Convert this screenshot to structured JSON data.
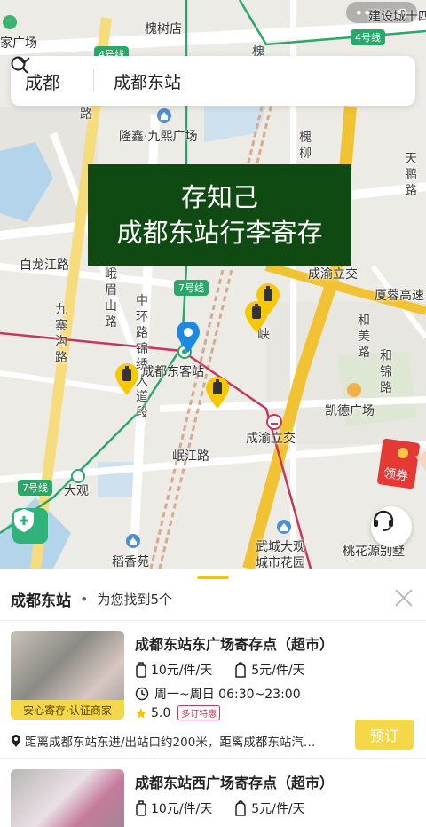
{
  "map": {
    "labels": {
      "huaishu_store": "槐树店",
      "home_plaza": "家广场",
      "longxin_plaza": "隆鑫·九熙广场",
      "bailong_rd": "白龙江路",
      "jiuzhai_rd": "九寨沟路",
      "emei_rd": "峨眉山路",
      "zhonghuan_rd": "中环路锦绣大道段",
      "east_station": "成都东客站",
      "minjiang_rd": "岷江路",
      "chengyu_lijiao_top": "成渝立交",
      "chengyu_lijiao": "成渝立交",
      "xiamen_rong": "厦蓉高速",
      "hemei_rd": "和美路",
      "jinhe_rd": "和锦路",
      "kaide_plaza": "凯德广场",
      "daguan": "大观",
      "daoxiangyuan": "稻香苑",
      "wucheng": "武城大观",
      "city_garden": "城市花园",
      "taohua_villa": "桃花源别墅",
      "tianpeng_rd": "天鹏路",
      "huai_rd": "槐",
      "huaishu_rd": "槐柳",
      "xia_rd": "峡",
      "shan_rd": "山路",
      "lu_top": "路",
      "jiandi": "建设城十四",
      "huai_top": "槐"
    },
    "metro_badges": [
      "4号线",
      "4号线",
      "7号线",
      "7号线"
    ],
    "top_dots": "•••",
    "colors": {
      "metro7": "#2aa86a",
      "metro_red": "#c8365a",
      "highway": "#f1c232",
      "water": "#b3d4ea"
    }
  },
  "search": {
    "city": "成都",
    "query": "成都东站"
  },
  "banner": {
    "line1": "存知己",
    "line2": "成都东站行李寄存"
  },
  "coupon": {
    "label": "领券"
  },
  "sheet": {
    "location": "成都东站",
    "dot": "•",
    "result_text": "为您找到5个"
  },
  "stores": [
    {
      "title": "成都东站东广场寄存点（超市）",
      "price_luggage": "10元/件/天",
      "price_bag": "5元/件/天",
      "hours": "周一~周日 06:30~23:00",
      "rating": "5.0",
      "discount": "多订特惠",
      "badge": "安心寄存·认证商家",
      "address": "距离成都东站东进/出站口约200米，距离成都东站汽…",
      "book_label": "预订"
    },
    {
      "title": "成都东站西广场寄存点（超市）",
      "price_luggage": "10元/件/天",
      "price_bag": "5元/件/天"
    }
  ]
}
